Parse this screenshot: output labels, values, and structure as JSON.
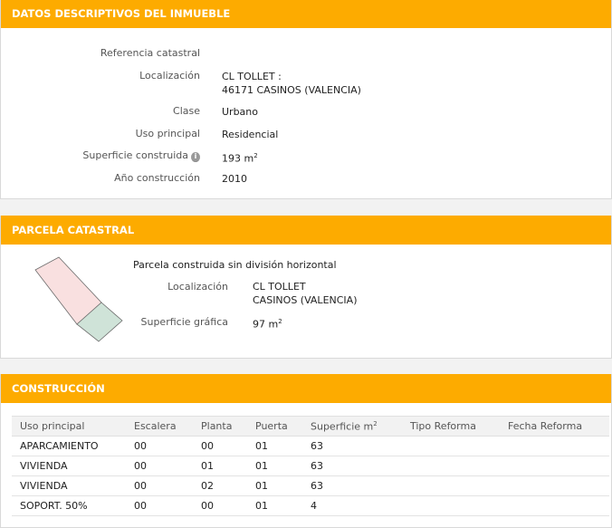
{
  "datos": {
    "header": "DATOS DESCRIPTIVOS DEL INMUEBLE",
    "rows": [
      {
        "label": "Referencia catastral",
        "value": ""
      },
      {
        "label": "Localización",
        "value_line1": "CL TOLLET :",
        "value_line2": "46171 CASINOS (VALENCIA)"
      },
      {
        "label": "Clase",
        "value": "Urbano"
      },
      {
        "label": "Uso principal",
        "value": "Residencial"
      },
      {
        "label": "Superficie construida",
        "value": "193 m",
        "sup": "2"
      },
      {
        "label": "Año construcción",
        "value": "2010"
      }
    ]
  },
  "parcela": {
    "header": "PARCELA CATASTRAL",
    "title": "Parcela construida sin división horizontal",
    "localizacion_label": "Localización",
    "localizacion_line1": "CL TOLLET",
    "localizacion_line2": "CASINOS (VALENCIA)",
    "superficie_label": "Superficie gráfica",
    "superficie_value": "97 m",
    "superficie_sup": "2",
    "colors": {
      "built": "#f9e0e0",
      "garden": "#cfe3d8",
      "outline": "#6d6d6d"
    }
  },
  "construccion": {
    "header": "CONSTRUCCIÓN",
    "columns": [
      "Uso principal",
      "Escalera",
      "Planta",
      "Puerta",
      "Superficie m",
      "Tipo Reforma",
      "Fecha Reforma"
    ],
    "sup_col": "2",
    "rows": [
      [
        "APARCAMIENTO",
        "00",
        "00",
        "01",
        "63",
        "",
        ""
      ],
      [
        "VIVIENDA",
        "00",
        "01",
        "01",
        "63",
        "",
        ""
      ],
      [
        "VIVIENDA",
        "00",
        "02",
        "01",
        "63",
        "",
        ""
      ],
      [
        "SOPORT. 50%",
        "00",
        "00",
        "01",
        "4",
        "",
        ""
      ]
    ]
  },
  "theme": {
    "accent": "#fdab00"
  }
}
